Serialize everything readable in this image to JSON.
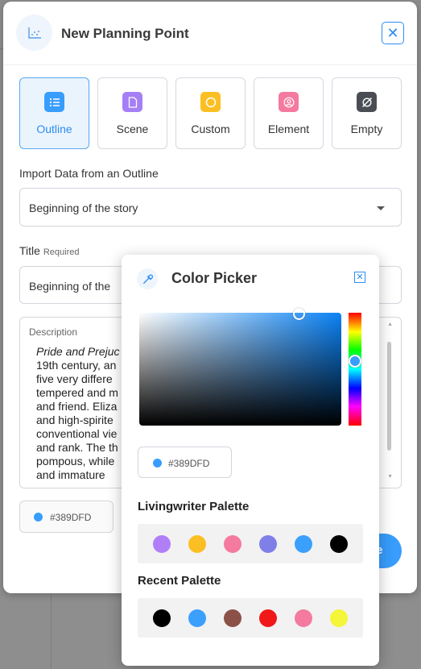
{
  "header": {
    "title": "New Planning Point",
    "close_label": "✕"
  },
  "tiles": [
    {
      "label": "Outline",
      "icon": "list-icon",
      "color": "#389dfd",
      "active": true
    },
    {
      "label": "Scene",
      "icon": "document-icon",
      "color": "#a57ff5",
      "active": false
    },
    {
      "label": "Custom",
      "icon": "circle-icon",
      "color": "#fbbf24",
      "active": false
    },
    {
      "label": "Element",
      "icon": "user-circle-icon",
      "color": "#f47aa0",
      "active": false
    },
    {
      "label": "Empty",
      "icon": "empty-set-icon",
      "color": "#4a4e54",
      "active": false
    }
  ],
  "import": {
    "label": "Import Data from an Outline",
    "value": "Beginning of the story"
  },
  "title_field": {
    "label": "Title",
    "required": "Required",
    "value": "Beginning of the"
  },
  "description": {
    "label": "Description",
    "lead": "Pride and Prejuc",
    "text": "19th century, an\nfive very differe\ntempered and m\nand friend. Eliza\nand high-spirite\nconventional vie\nand rank. The th\npompous, while\nand immature"
  },
  "color_button": {
    "hex": "#389DFD",
    "color": "#389dfd"
  },
  "save_button": {
    "label": "e"
  },
  "picker": {
    "title": "Color Picker",
    "close_label": "✕",
    "hex": "#389DFD",
    "color": "#389dfd",
    "palettes": {
      "livingwriter": {
        "label": "Livingwriter Palette",
        "swatches": [
          "#b07ff7",
          "#fbbf24",
          "#f47aa0",
          "#7e80e8",
          "#3ba0fc",
          "#000000"
        ]
      },
      "recent": {
        "label": "Recent Palette",
        "swatches": [
          "#000000",
          "#3ba0fc",
          "#8b5148",
          "#f01818",
          "#f47aa0",
          "#f5f53a"
        ]
      }
    }
  }
}
